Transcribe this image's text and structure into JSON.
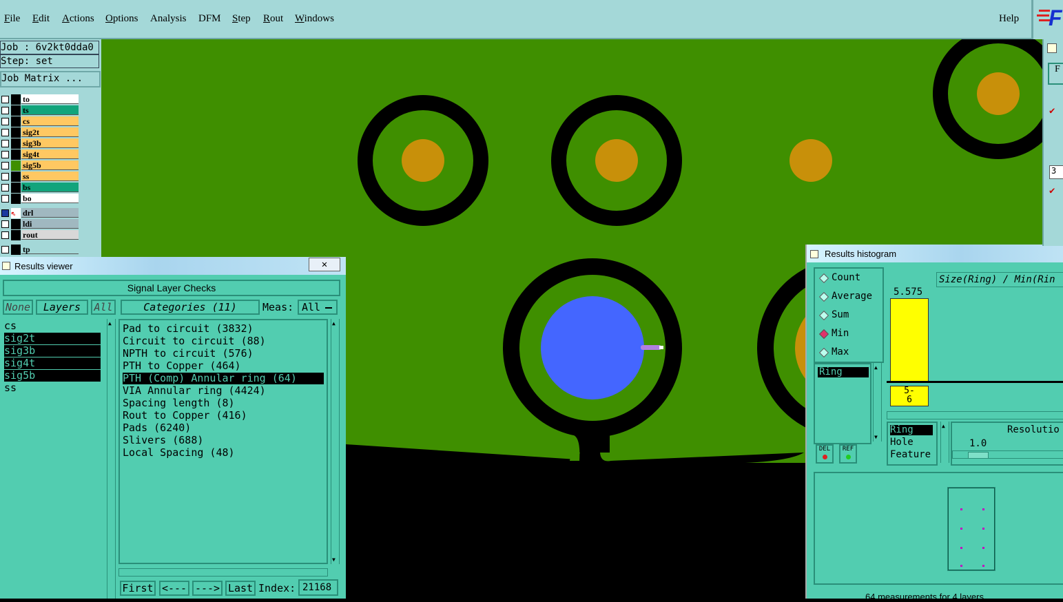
{
  "menubar": {
    "items": [
      {
        "label": "File",
        "u": "F",
        "rest": "ile"
      },
      {
        "label": "Edit",
        "u": "E",
        "rest": "dit"
      },
      {
        "label": "Actions",
        "u": "A",
        "rest": "ctions"
      },
      {
        "label": "Options",
        "u": "O",
        "rest": "ptions"
      },
      {
        "label": "Analysis",
        "u": "A",
        "rest": "nalysis"
      },
      {
        "label": "DFM",
        "u": "D",
        "rest": "FM"
      },
      {
        "label": "Step",
        "u": "S",
        "rest": "tep"
      },
      {
        "label": "Rout",
        "u": "R",
        "rest": "out"
      },
      {
        "label": "Windows",
        "u": "W",
        "rest": "indows"
      }
    ],
    "help": "Help",
    "logo_text": "F"
  },
  "job": {
    "job_line": "Job : 6v2kt0dda0",
    "step_line": "Step: set",
    "matrix_button": "Job Matrix ..."
  },
  "layers": [
    {
      "name": "to",
      "color": "#ffffff"
    },
    {
      "name": "ts",
      "color": "#12a47c"
    },
    {
      "name": "cs",
      "color": "#ffc862"
    },
    {
      "name": "sig2t",
      "color": "#ffc862"
    },
    {
      "name": "sig3b",
      "color": "#ffc862"
    },
    {
      "name": "sig4t",
      "color": "#ffc862"
    },
    {
      "name": "sig5b",
      "color": "#ffc862"
    },
    {
      "name": "ss",
      "color": "#ffc862"
    },
    {
      "name": "bs",
      "color": "#12a47c"
    },
    {
      "name": "bo",
      "color": "#ffffff"
    },
    {
      "name": "drl",
      "color": "#a0b8c0"
    },
    {
      "name": "ldi",
      "color": "#a0b8c0"
    },
    {
      "name": "rout",
      "color": "#d8d8d8"
    },
    {
      "name": "tp",
      "color": "#a4d8d8"
    }
  ],
  "results_viewer": {
    "title": "Results viewer",
    "header": "Signal Layer Checks",
    "none_btn": "None",
    "layers_btn": "Layers",
    "all_btn": "All",
    "categories_btn": "Categories (11)",
    "meas_label": "Meas:",
    "meas_value": "All",
    "layer_list": [
      "cs",
      "sig2t",
      "sig3b",
      "sig4t",
      "sig5b",
      "ss"
    ],
    "selected_layers": [
      1,
      2,
      3,
      4
    ],
    "categories": [
      "Pad to circuit (3832)",
      "Circuit to circuit (88)",
      "NPTH to circuit (576)",
      "PTH to Copper (464)",
      "PTH (Comp) Annular ring (64)",
      "VIA Annular ring (4424)",
      "Spacing length (8)",
      "Rout to Copper (416)",
      "Pads (6240)",
      "Slivers (688)",
      "Local Spacing (48)"
    ],
    "selected_category": 4,
    "nav": {
      "first": "First",
      "prev": "<---",
      "next": "--->",
      "last": "Last",
      "index_label": "Index:",
      "index_value": "21168"
    }
  },
  "histogram": {
    "title": "Results histogram",
    "modes": [
      "Count",
      "Average",
      "Sum",
      "Min",
      "Max"
    ],
    "selected_mode": "Min",
    "header": "Size(Ring) / Min(Rin",
    "bar_value": "5.575",
    "bin_label_1": "5-",
    "bin_label_2": "6",
    "list_item": "Ring",
    "del_btn": "DEL",
    "ref_btn": "REF",
    "fields": [
      "Ring",
      "Hole",
      "Feature"
    ],
    "selected_field": "Ring",
    "resolution_label": "Resolutio",
    "resolution_value": "1.0",
    "status": "64 measurements for 4 layers"
  },
  "right_edge": {
    "letter1": "F",
    "num": "3"
  },
  "colors": {
    "panel": "#a4d8d8",
    "viewer": "#52cdb0",
    "board_green": "#3f8f00",
    "pad_gold": "#c8900a",
    "highlight_blue": "#4466ff",
    "bar_yellow": "#ffff00"
  }
}
